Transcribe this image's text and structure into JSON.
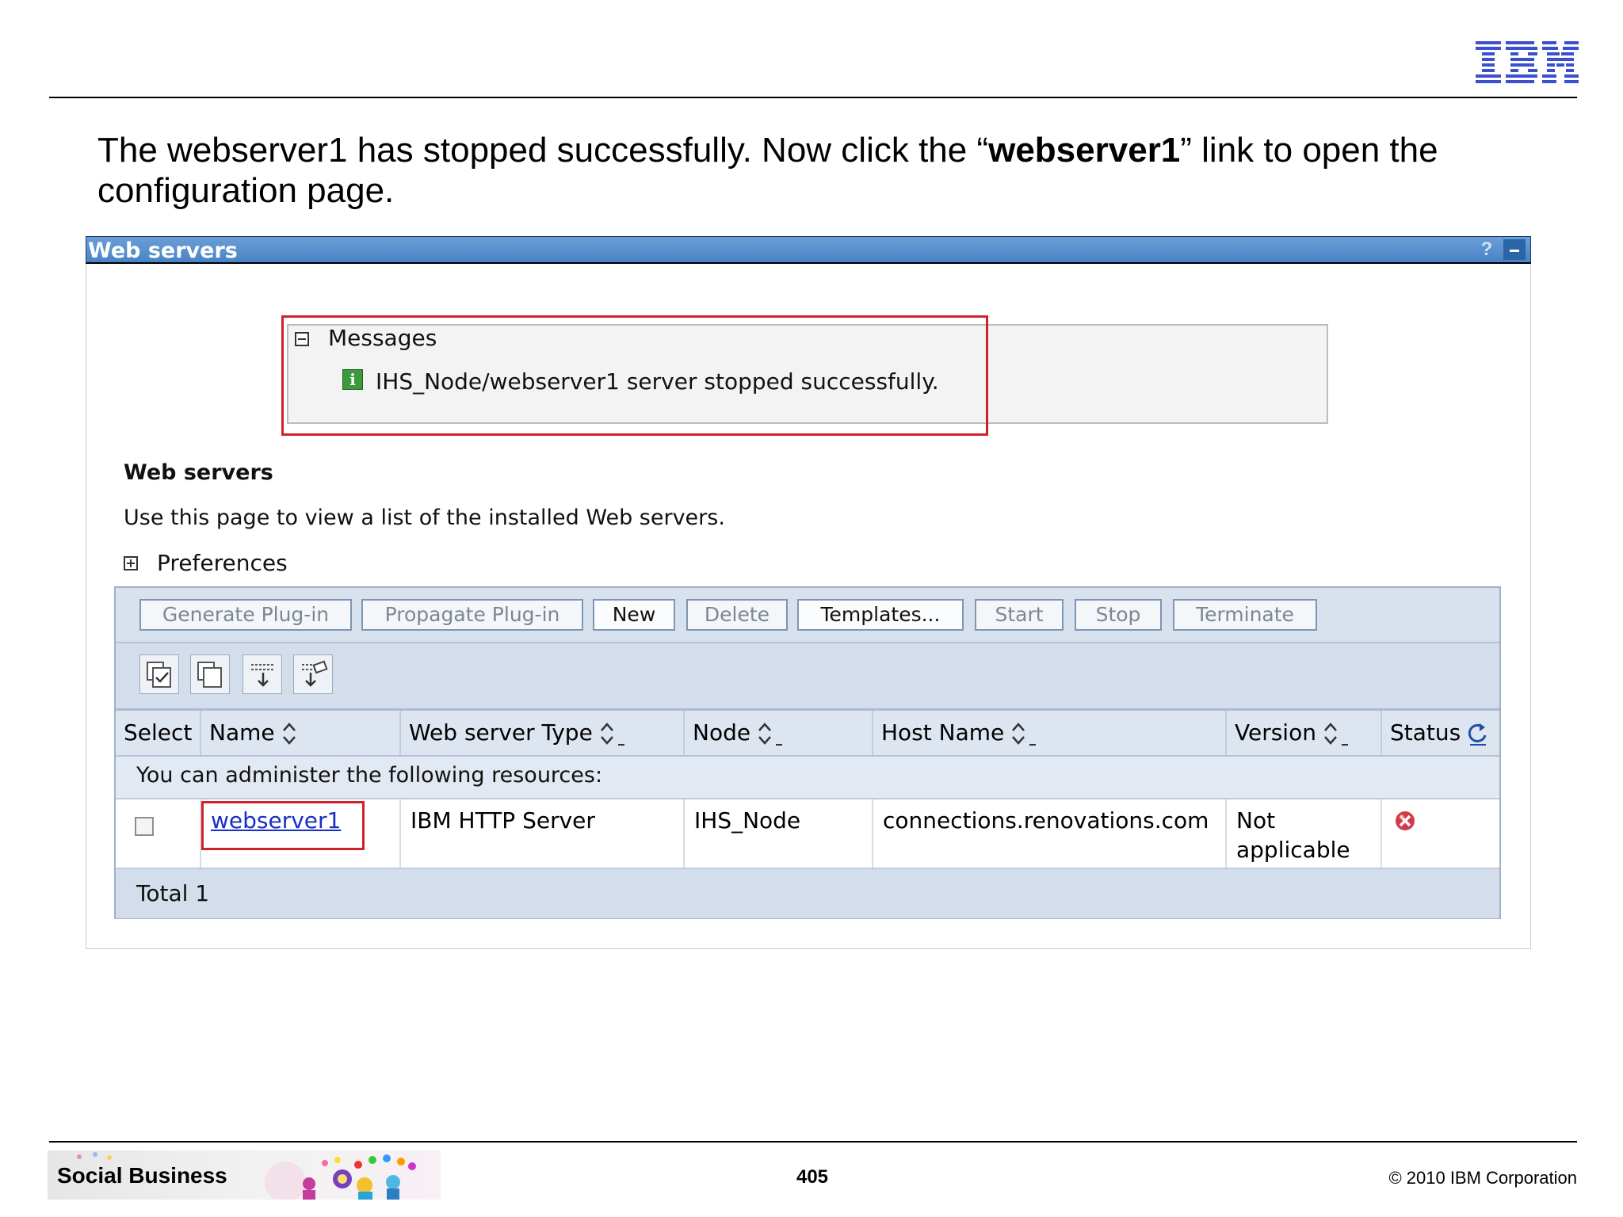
{
  "slide": {
    "instruction_prefix": "The webserver1 has stopped successfully. Now click the “",
    "instruction_bold": "webserver1",
    "instruction_suffix": "” link to open the configuration page.",
    "footer_brand": "Social Business",
    "page_number": "405",
    "copyright": "© 2010 IBM Corporation",
    "logo": "IBM"
  },
  "portlet": {
    "title": "Web servers",
    "help_label": "?"
  },
  "messages": {
    "label": "Messages",
    "text": "IHS_Node/webserver1 server stopped successfully.",
    "icon": "info-icon"
  },
  "page": {
    "heading": "Web servers",
    "description": "Use this page to view a list of the installed Web servers.",
    "preferences_label": "Preferences"
  },
  "toolbar": {
    "buttons": [
      {
        "label": "Generate Plug-in",
        "enabled": false
      },
      {
        "label": "Propagate Plug-in",
        "enabled": false
      },
      {
        "label": "New",
        "enabled": true
      },
      {
        "label": "Delete",
        "enabled": false
      },
      {
        "label": "Templates...",
        "enabled": true
      },
      {
        "label": "Start",
        "enabled": false
      },
      {
        "label": "Stop",
        "enabled": false
      },
      {
        "label": "Terminate",
        "enabled": false
      }
    ],
    "icons": [
      "select-all-icon",
      "deselect-all-icon",
      "show-filter-icon",
      "clear-filter-icon"
    ]
  },
  "table": {
    "columns": [
      "Select",
      "Name",
      "Web server Type",
      "Node",
      "Host Name",
      "Version",
      "Status"
    ],
    "admin_text": "You can administer the following resources:",
    "rows": [
      {
        "name": "webserver1",
        "type": "IBM HTTP Server",
        "node": "IHS_Node",
        "host": "connections.renovations.com",
        "version": "Not applicable",
        "status": "stopped"
      }
    ],
    "total": "Total 1"
  },
  "colors": {
    "highlight": "#d0202a",
    "link": "#1a2fc2",
    "titlebar": "#4a83c6"
  }
}
